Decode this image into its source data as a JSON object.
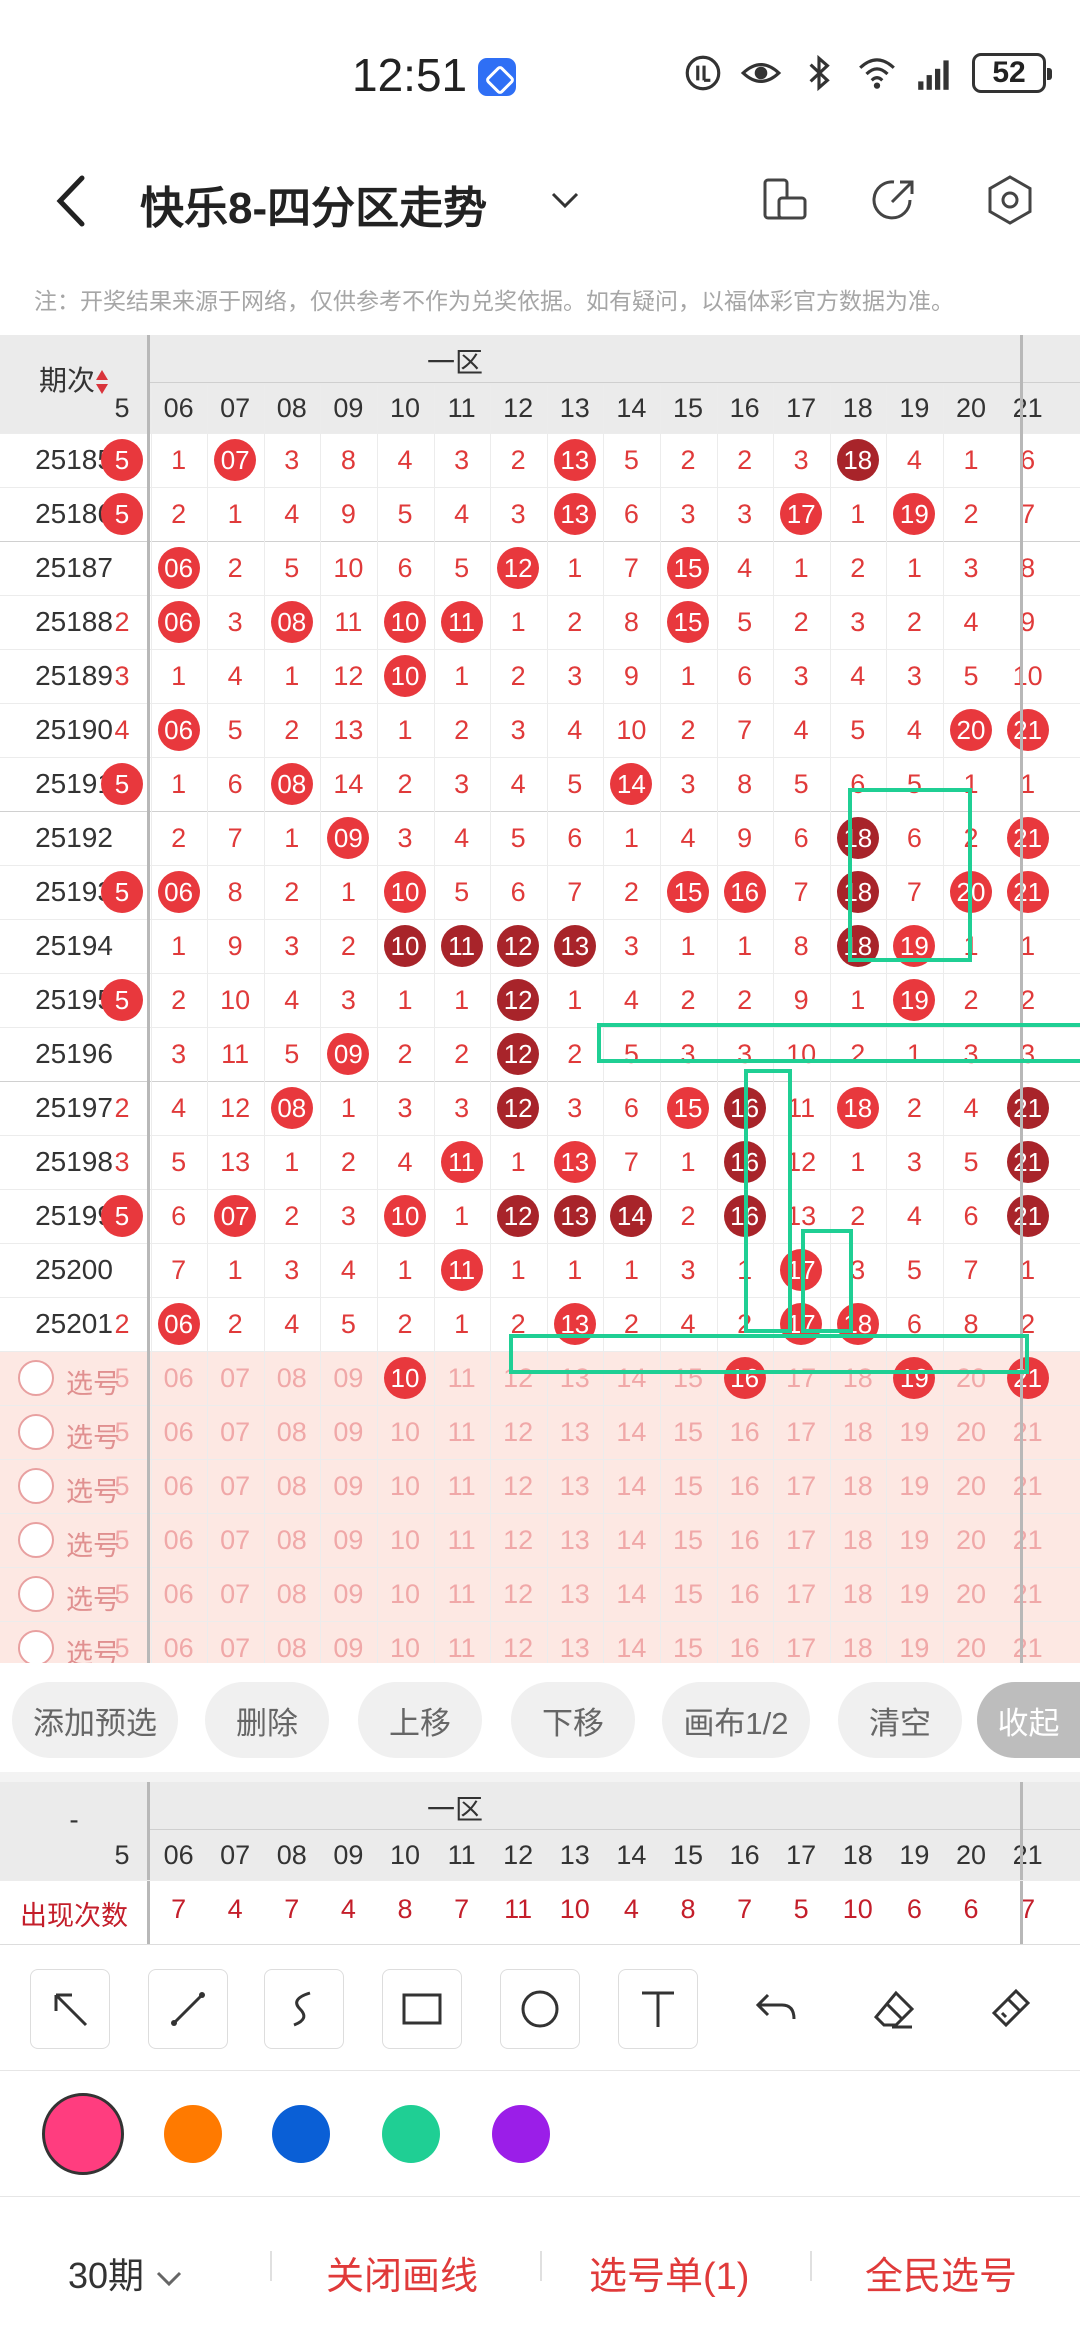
{
  "status": {
    "time": "12:51",
    "battery": "52"
  },
  "header": {
    "title": "快乐8-四分区走势"
  },
  "notice": "注：开奖结果来源于网络，仅供参考不作为兑奖依据。如有疑问，以福体彩官方数据为准。",
  "table": {
    "period_header": "期次",
    "zone_label": "一区",
    "columns": [
      "5",
      "06",
      "07",
      "08",
      "09",
      "10",
      "11",
      "12",
      "13",
      "14",
      "15",
      "16",
      "17",
      "18",
      "19",
      "20",
      "21"
    ],
    "rows": [
      {
        "period": "25185",
        "cells": [
          "5",
          "1",
          "07",
          "3",
          "8",
          "4",
          "3",
          "2",
          "13",
          "5",
          "2",
          "2",
          "3",
          "18",
          "4",
          "1",
          "6"
        ]
      },
      {
        "period": "25186",
        "cells": [
          "5",
          "2",
          "1",
          "4",
          "9",
          "5",
          "4",
          "3",
          "13",
          "6",
          "3",
          "3",
          "17",
          "1",
          "19",
          "2",
          "7"
        ]
      },
      {
        "period": "25187",
        "cells": [
          "",
          "06",
          "2",
          "5",
          "10",
          "6",
          "5",
          "12",
          "1",
          "7",
          "15",
          "4",
          "1",
          "2",
          "1",
          "3",
          "8"
        ]
      },
      {
        "period": "25188",
        "cells": [
          "2",
          "06",
          "3",
          "08",
          "11",
          "10",
          "11",
          "1",
          "2",
          "8",
          "15",
          "5",
          "2",
          "3",
          "2",
          "4",
          "9"
        ]
      },
      {
        "period": "25189",
        "cells": [
          "3",
          "1",
          "4",
          "1",
          "12",
          "10",
          "1",
          "2",
          "3",
          "9",
          "1",
          "6",
          "3",
          "4",
          "3",
          "5",
          "10"
        ]
      },
      {
        "period": "25190",
        "cells": [
          "4",
          "06",
          "5",
          "2",
          "13",
          "1",
          "2",
          "3",
          "4",
          "10",
          "2",
          "7",
          "4",
          "5",
          "4",
          "20",
          "21"
        ]
      },
      {
        "period": "25191",
        "cells": [
          "5",
          "1",
          "6",
          "08",
          "14",
          "2",
          "3",
          "4",
          "5",
          "14",
          "3",
          "8",
          "5",
          "6",
          "5",
          "1",
          "1"
        ]
      },
      {
        "period": "25192",
        "cells": [
          "",
          "2",
          "7",
          "1",
          "09",
          "3",
          "4",
          "5",
          "6",
          "1",
          "4",
          "9",
          "6",
          "18",
          "6",
          "2",
          "21"
        ]
      },
      {
        "period": "25193",
        "cells": [
          "5",
          "06",
          "8",
          "2",
          "1",
          "10",
          "5",
          "6",
          "7",
          "2",
          "15",
          "16",
          "7",
          "18",
          "7",
          "20",
          "21"
        ]
      },
      {
        "period": "25194",
        "cells": [
          "",
          "1",
          "9",
          "3",
          "2",
          "10",
          "11",
          "12",
          "13",
          "3",
          "1",
          "1",
          "8",
          "18",
          "19",
          "1",
          "1"
        ]
      },
      {
        "period": "25195",
        "cells": [
          "5",
          "2",
          "10",
          "4",
          "3",
          "1",
          "1",
          "12",
          "1",
          "4",
          "2",
          "2",
          "9",
          "1",
          "19",
          "2",
          "2"
        ]
      },
      {
        "period": "25196",
        "cells": [
          "",
          "3",
          "11",
          "5",
          "09",
          "2",
          "2",
          "12",
          "2",
          "5",
          "3",
          "3",
          "10",
          "2",
          "1",
          "3",
          "3"
        ]
      },
      {
        "period": "25197",
        "cells": [
          "2",
          "4",
          "12",
          "08",
          "1",
          "3",
          "3",
          "12",
          "3",
          "6",
          "15",
          "16",
          "11",
          "18",
          "2",
          "4",
          "21"
        ]
      },
      {
        "period": "25198",
        "cells": [
          "3",
          "5",
          "13",
          "1",
          "2",
          "4",
          "11",
          "1",
          "13",
          "7",
          "1",
          "16",
          "12",
          "1",
          "3",
          "5",
          "21"
        ]
      },
      {
        "period": "25199",
        "cells": [
          "5",
          "6",
          "07",
          "2",
          "3",
          "10",
          "1",
          "12",
          "13",
          "14",
          "2",
          "16",
          "13",
          "2",
          "4",
          "6",
          "21"
        ]
      },
      {
        "period": "25200",
        "cells": [
          "",
          "7",
          "1",
          "3",
          "4",
          "1",
          "11",
          "1",
          "1",
          "1",
          "3",
          "1",
          "17",
          "3",
          "5",
          "7",
          "1"
        ]
      },
      {
        "period": "25201",
        "cells": [
          "2",
          "06",
          "2",
          "4",
          "5",
          "2",
          "1",
          "2",
          "13",
          "2",
          "4",
          "2",
          "17",
          "18",
          "6",
          "8",
          "2"
        ]
      }
    ],
    "preselect_label": "选号",
    "preselect_rows": [
      [
        "5",
        "06",
        "07",
        "08",
        "09",
        "10",
        "11",
        "12",
        "13",
        "14",
        "15",
        "16",
        "17",
        "18",
        "19",
        "20",
        "21"
      ],
      [
        "5",
        "06",
        "07",
        "08",
        "09",
        "10",
        "11",
        "12",
        "13",
        "14",
        "15",
        "16",
        "17",
        "18",
        "19",
        "20",
        "21"
      ],
      [
        "5",
        "06",
        "07",
        "08",
        "09",
        "10",
        "11",
        "12",
        "13",
        "14",
        "15",
        "16",
        "17",
        "18",
        "19",
        "20",
        "21"
      ],
      [
        "5",
        "06",
        "07",
        "08",
        "09",
        "10",
        "11",
        "12",
        "13",
        "14",
        "15",
        "16",
        "17",
        "18",
        "19",
        "20",
        "21"
      ],
      [
        "5",
        "06",
        "07",
        "08",
        "09",
        "10",
        "11",
        "12",
        "13",
        "14",
        "15",
        "16",
        "17",
        "18",
        "19",
        "20",
        "21"
      ],
      [
        "5",
        "06",
        "07",
        "08",
        "09",
        "10",
        "11",
        "12",
        "13",
        "14",
        "15",
        "16",
        "17",
        "18",
        "19",
        "20",
        "21"
      ]
    ],
    "preselect_selected": [
      "10",
      "16",
      "19",
      "21"
    ]
  },
  "actions": {
    "add": "添加预选",
    "delete": "删除",
    "up": "上移",
    "down": "下移",
    "canvas": "画布1/2",
    "clear": "清空",
    "collapse": "收起"
  },
  "stats": {
    "corner": "-",
    "zone_label": "一区",
    "label": "出现次数",
    "values": [
      "",
      "7",
      "4",
      "7",
      "4",
      "8",
      "7",
      "11",
      "10",
      "4",
      "8",
      "7",
      "5",
      "10",
      "6",
      "6",
      "7"
    ]
  },
  "colors": {
    "pink": "#ff3d7f",
    "orange": "#ff7a00",
    "blue": "#0a5fd6",
    "green": "#1fcf94",
    "purple": "#9b1ee8",
    "accent": "#e03a3a"
  },
  "nav": {
    "period": "30期",
    "close_draw": "关闭画线",
    "picklist": "选号单(1)",
    "all_pick": "全民选号"
  }
}
